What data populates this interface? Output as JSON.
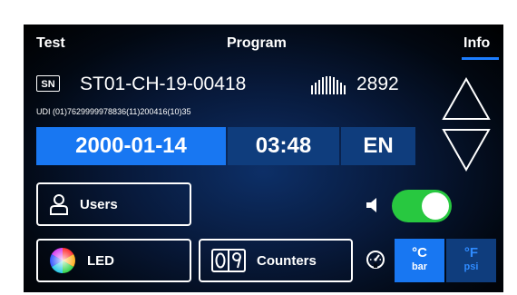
{
  "tabs": {
    "test": "Test",
    "program": "Program",
    "info": "Info",
    "active": "Info"
  },
  "device": {
    "sn_badge": "SN",
    "serial": "ST01-CH-19-00418",
    "count": "2892",
    "udi": "UDI (01)7629999978836(11)200416(10)35"
  },
  "datetime": {
    "date": "2000-01-14",
    "time": "03:48",
    "language": "EN"
  },
  "buttons": {
    "users": "Users",
    "led": "LED",
    "counters": "Counters"
  },
  "sound": {
    "enabled": true
  },
  "units": {
    "celsius": "°C",
    "bar": "bar",
    "fahrenheit": "°F",
    "psi": "psi",
    "selected": "°C bar"
  },
  "colors": {
    "accent": "#1877f2",
    "dark_blue": "#0f3d7d",
    "toggle_on": "#28c840",
    "background": "#020812"
  },
  "icons": {
    "sn": "sn-badge-icon",
    "barcode": "barcode-icon",
    "up": "arrow-up-icon",
    "down": "arrow-down-icon",
    "users": "user-icon",
    "led": "color-wheel-icon",
    "counters": "counter-icon",
    "speaker": "speaker-icon",
    "gauge": "gauge-icon"
  }
}
